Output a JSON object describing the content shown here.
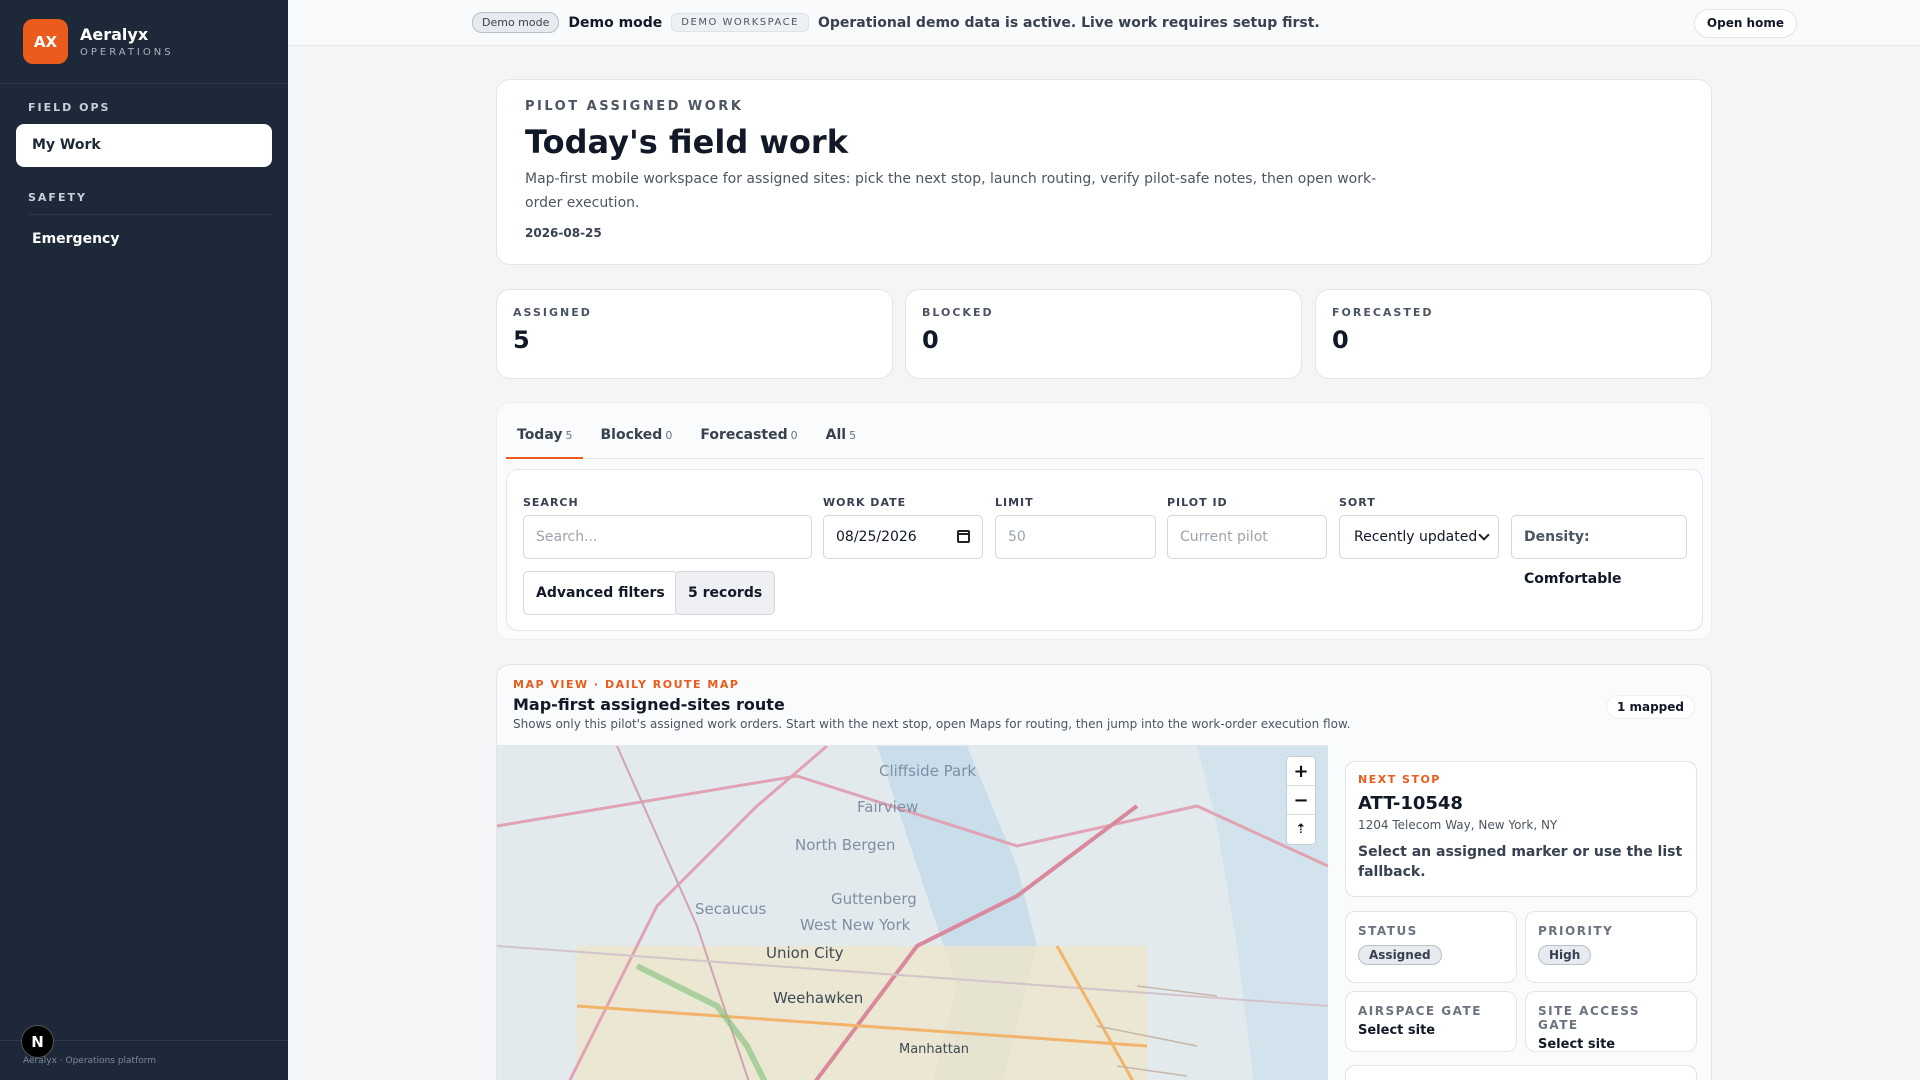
{
  "brand": {
    "logo": "AX",
    "name": "Aeralyx",
    "sub": "OPERATIONS"
  },
  "sidebar": {
    "sections": [
      {
        "title": "FIELD OPS",
        "items": [
          {
            "label": "My Work",
            "active": true
          }
        ]
      },
      {
        "title": "SAFETY",
        "items": [
          {
            "label": "Emergency",
            "active": false
          }
        ]
      }
    ],
    "footer": "Aeralyx · Operations platform",
    "next_badge": "N"
  },
  "topbar": {
    "pill": "Demo mode",
    "demo_text": "Demo mode",
    "workspace_pill": "DEMO WORKSPACE",
    "message": "Operational demo data is active. Live work requires setup first.",
    "open_home": "Open home"
  },
  "hero": {
    "eyebrow": "PILOT ASSIGNED WORK",
    "title": "Today's field work",
    "description": "Map-first mobile workspace for assigned sites: pick the next stop, launch routing, verify pilot-safe notes, then open work-order execution.",
    "date": "2026-08-25"
  },
  "stats": [
    {
      "label": "ASSIGNED",
      "value": "5"
    },
    {
      "label": "BLOCKED",
      "value": "0"
    },
    {
      "label": "FORECASTED",
      "value": "0"
    }
  ],
  "tabs": [
    {
      "label": "Today",
      "count": "5",
      "active": true
    },
    {
      "label": "Blocked",
      "count": "0",
      "active": false
    },
    {
      "label": "Forecasted",
      "count": "0",
      "active": false
    },
    {
      "label": "All",
      "count": "5",
      "active": false
    }
  ],
  "filters": {
    "search": {
      "label": "SEARCH",
      "placeholder": "Search..."
    },
    "work_date": {
      "label": "WORK DATE",
      "value": "08/25/2026"
    },
    "limit": {
      "label": "LIMIT",
      "placeholder": "50"
    },
    "pilot_id": {
      "label": "PILOT ID",
      "placeholder": "Current pilot"
    },
    "sort": {
      "label": "SORT",
      "value": "Recently updated"
    },
    "density": {
      "label": "Density:",
      "value": "Comfortable"
    },
    "advanced": "Advanced filters",
    "records": "5 records"
  },
  "map": {
    "eyebrow": "MAP VIEW · DAILY ROUTE MAP",
    "title": "Map-first assigned-sites route",
    "description": "Shows only this pilot's assigned work orders. Start with the next stop, open Maps for routing, then jump into the work-order execution flow.",
    "mapped": "1 mapped",
    "labels": [
      "Cliffside Park",
      "Fairview",
      "North Bergen",
      "Guttenberg",
      "Secaucus",
      "West New York",
      "Union City",
      "Weehawken",
      "Manhattan"
    ],
    "zoom_in": "+",
    "zoom_out": "−",
    "reset": "⇡"
  },
  "next_stop": {
    "eyebrow": "NEXT STOP",
    "id": "ATT-10548",
    "address": "1204 Telecom Way, New York, NY",
    "hint": "Select an assigned marker or use the list fallback.",
    "status_label": "STATUS",
    "status_value": "Assigned",
    "priority_label": "PRIORITY",
    "priority_value": "High",
    "airspace_label": "AIRSPACE GATE",
    "airspace_value": "Select site",
    "site_access_label": "SITE ACCESS GATE",
    "site_access_value": "Select site"
  },
  "colors": {
    "accent": "#ea5b1c",
    "sidebar_bg": "#1d2939"
  }
}
